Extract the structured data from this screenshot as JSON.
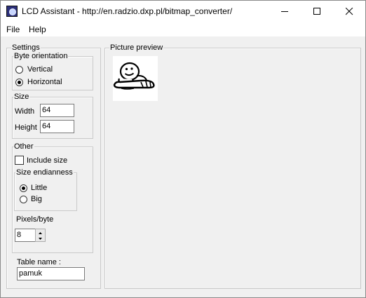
{
  "window": {
    "title": "LCD Assistant -  http://en.radzio.dxp.pl/bitmap_converter/",
    "app_icon": "lcd-assistant-icon",
    "controls": [
      "minimize-icon",
      "maximize-icon",
      "close-icon"
    ]
  },
  "menu": [
    {
      "label": "File"
    },
    {
      "label": "Help"
    }
  ],
  "settings": {
    "title": "Settings",
    "byte_orientation": {
      "title": "Byte orientation",
      "options": [
        "Vertical",
        "Horizontal"
      ],
      "selected": "Horizontal"
    },
    "size": {
      "title": "Size",
      "width_label": "Width",
      "width_value": "64",
      "height_label": "Height",
      "height_value": "64"
    },
    "other": {
      "title": "Other",
      "include_size_label": "Include size",
      "include_size_checked": false,
      "endianness": {
        "title": "Size endianness",
        "options": [
          "Little",
          "Big"
        ],
        "selected": "Little"
      },
      "pixels_per_byte_label": "Pixels/byte",
      "pixels_per_byte_value": "8"
    },
    "table_name_label": "Table name :",
    "table_name_value": "pamuk"
  },
  "preview": {
    "title": "Picture preview",
    "image": "bitmap-preview"
  }
}
